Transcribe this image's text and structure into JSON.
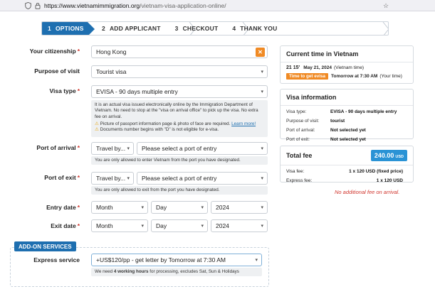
{
  "browser": {
    "url_host": "https://www.vietnamimmigration.org",
    "url_path": "/vietnam-visa-application-online/"
  },
  "steps": [
    {
      "num": "1",
      "label": "OPTIONS"
    },
    {
      "num": "2",
      "label": "ADD APPLICANT"
    },
    {
      "num": "3",
      "label": "CHECKOUT"
    },
    {
      "num": "4",
      "label": "THANK YOU"
    }
  ],
  "form": {
    "citizenship": {
      "label": "Your citizenship",
      "value": "Hong Kong"
    },
    "purpose": {
      "label": "Purpose of visit",
      "value": "Tourist visa"
    },
    "visa_type": {
      "label": "Visa type",
      "value": "EVISA - 90 days multiple entry",
      "note1": "It is an actual visa issued electronically online by the Immigration Department of Vietnam. No need to stop at the \"visa on arrival office\" to pick up the visa. No extra fee on arrival.",
      "note2a": "Picture of passport information page & photo of face are required. ",
      "note2_link": "Learn more!",
      "note3": "Documents number begins with \"D\" is not eligible for e-visa."
    },
    "arrival": {
      "label": "Port of arrival",
      "method": "Travel by...",
      "port": "Please select a port of entry",
      "note": "You are only allowed to enter Vietnam from the port you have designated."
    },
    "exit": {
      "label": "Port of exit",
      "method": "Travel by...",
      "port": "Please select a port of entry",
      "note": "You are only allowed to exit from the port you have designated."
    },
    "entry_date": {
      "label": "Entry date",
      "month": "Month",
      "day": "Day",
      "year": "2024"
    },
    "exit_date": {
      "label": "Exit date",
      "month": "Month",
      "day": "Day",
      "year": "2024"
    }
  },
  "addon": {
    "tab": "ADD-ON SERVICES",
    "express_label": "Express service",
    "express_value": "+US$120/pp - get letter by Tomorrow at 7:30 AM",
    "note_a": "We need ",
    "note_bold": "4 working hours",
    "note_b": " for processing, excludes Sat, Sun & Holidays"
  },
  "vn_time": {
    "title": "Current time in Vietnam",
    "clock": "21 15'",
    "date": "May 21, 2024",
    "tz": "(Vietnam time)",
    "badge": "Time to get evisa",
    "get_time": "Tomorrow at 7:30 AM",
    "get_tz": "(Your time)"
  },
  "visa_info": {
    "title": "Visa information",
    "rows": [
      {
        "k": "Visa type:",
        "v": "EVISA - 90 days multiple entry"
      },
      {
        "k": "Purpose of visit:",
        "v": "tourist"
      },
      {
        "k": "Port of arrival:",
        "v": "Not selected yet"
      },
      {
        "k": "Port of exit:",
        "v": "Not selected yet"
      }
    ]
  },
  "fees": {
    "title": "Total fee",
    "total": "240.00",
    "currency": "USD",
    "rows": [
      {
        "k": "Visa fee:",
        "v": "1 x 120 USD (fixed price)"
      },
      {
        "k": "Express fee:",
        "v": "1 x 120 USD"
      }
    ],
    "no_extra": "No additional fee on arrival."
  },
  "colors": {
    "primary": "#1e6fb0",
    "accent": "#f08a24",
    "required": "#d0342c"
  }
}
